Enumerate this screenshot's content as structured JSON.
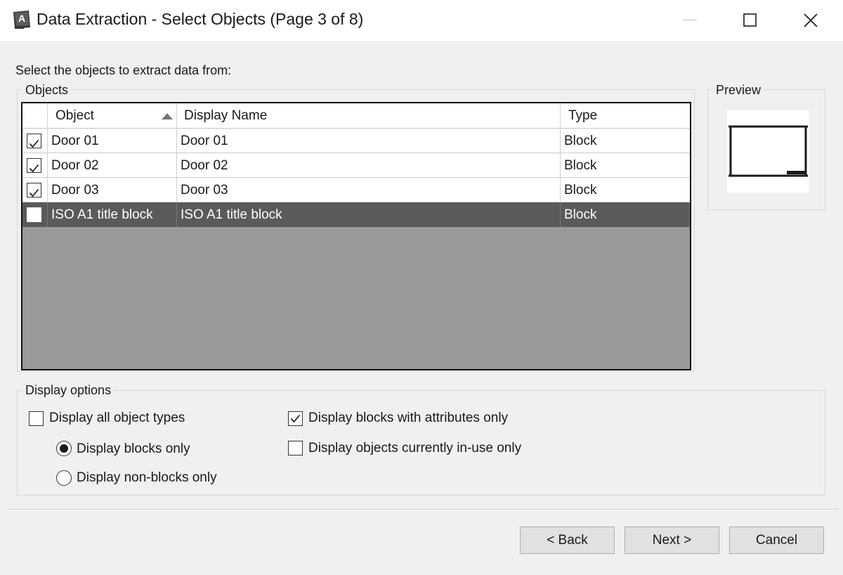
{
  "window": {
    "title": "Data Extraction - Select Objects (Page 3 of 8)",
    "app_icon": "autocad-app-icon",
    "app_icon_letter": "A",
    "controls": {
      "minimize": "minimize-icon",
      "maximize": "maximize-icon",
      "close": "close-icon"
    }
  },
  "prompt": "Select the objects to extract data from:",
  "objects_group": {
    "label": "Objects",
    "columns": {
      "object": "Object",
      "display_name": "Display Name",
      "type": "Type"
    },
    "sort_column": "Object",
    "sort_direction": "ascending",
    "rows": [
      {
        "checked": true,
        "object": "Door 01",
        "display_name": "Door 01",
        "type": "Block",
        "selected": false
      },
      {
        "checked": true,
        "object": "Door 02",
        "display_name": "Door 02",
        "type": "Block",
        "selected": false
      },
      {
        "checked": true,
        "object": "Door 03",
        "display_name": "Door 03",
        "type": "Block",
        "selected": false
      },
      {
        "checked": false,
        "object": "ISO A1 title block",
        "display_name": "ISO A1 title block",
        "type": "Block",
        "selected": true
      }
    ]
  },
  "preview": {
    "label": "Preview"
  },
  "display_options": {
    "label": "Display options",
    "all_object_types": {
      "label": "Display all object types",
      "checked": false
    },
    "blocks_only": {
      "label": "Display blocks only",
      "selected": true
    },
    "non_blocks_only": {
      "label": "Display non-blocks only",
      "selected": false
    },
    "blocks_with_attributes_only": {
      "label": "Display blocks with attributes only",
      "checked": true
    },
    "objects_in_use_only": {
      "label": "Display objects currently in-use only",
      "checked": false
    }
  },
  "buttons": {
    "back": "< Back",
    "next": "Next >",
    "cancel": "Cancel"
  },
  "colors": {
    "selected_row": "#5a5a5a",
    "grid_empty": "#9a9a9a",
    "dialog_bg": "#f0f0f0"
  }
}
